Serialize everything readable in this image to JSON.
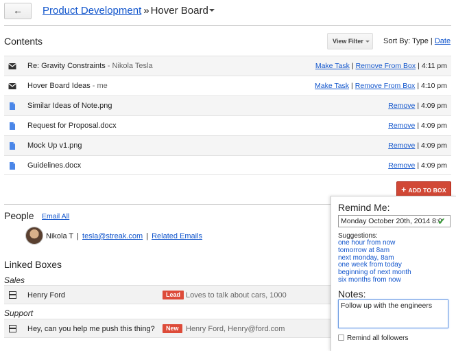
{
  "header": {
    "back_label": "←",
    "breadcrumb_link": "Product Development",
    "breadcrumb_sep": "»",
    "current": "Hover Board"
  },
  "contents": {
    "title": "Contents",
    "view_filter": "View Filter",
    "sort_label": "Sort By:",
    "sort_type": "Type",
    "sort_sep": "|",
    "sort_date": "Date",
    "rows": [
      {
        "icon": "envelope-icon",
        "title": "Re: Gravity Constraints",
        "who": "- Nikola Tesla",
        "a1": "Make Task",
        "a2": "Remove From Box",
        "time": "4:11 pm"
      },
      {
        "icon": "envelope-icon",
        "title": "Hover Board Ideas",
        "who": "- me",
        "a1": "Make Task",
        "a2": "Remove From Box",
        "time": "4:10 pm"
      },
      {
        "icon": "file-icon",
        "title": "Similar Ideas of Note.png",
        "who": "",
        "a1": "",
        "a2": "Remove",
        "time": "4:09 pm"
      },
      {
        "icon": "file-icon",
        "title": "Request for Proposal.docx",
        "who": "",
        "a1": "",
        "a2": "Remove",
        "time": "4:09 pm"
      },
      {
        "icon": "file-icon",
        "title": "Mock Up v1.png",
        "who": "",
        "a1": "",
        "a2": "Remove",
        "time": "4:09 pm"
      },
      {
        "icon": "file-icon",
        "title": "Guidelines.docx",
        "who": "",
        "a1": "",
        "a2": "Remove",
        "time": "4:09 pm"
      }
    ],
    "add_label": "ADD TO BOX"
  },
  "people": {
    "title": "People",
    "email_all": "Email All",
    "name": "Nikola T",
    "email": "tesla@streak.com",
    "related": "Related Emails"
  },
  "linked": {
    "title": "Linked Boxes",
    "groups": [
      {
        "stage": "Sales",
        "name": "Henry Ford",
        "badge": "Lead",
        "snippet": "Loves to talk about cars, 1000"
      },
      {
        "stage": "Support",
        "name": "Hey, can you help me push this thing?",
        "badge": "New",
        "snippet": "Henry Ford, Henry@ford.com"
      }
    ]
  },
  "reminder": {
    "title": "Remind Me:",
    "date_value": "Monday October 20th, 2014 8:0",
    "suggestions_label": "Suggestions:",
    "suggestions": [
      "one hour from now",
      "tomorrow at 8am",
      "next monday, 8am",
      "one week from today",
      "beginning of next month",
      "six months from now"
    ],
    "notes_label": "Notes:",
    "notes_value": "Follow up with the engineers",
    "remind_all": "Remind all followers"
  },
  "colors": {
    "link": "#1155cc",
    "accent_red": "#d14836",
    "badge_red": "#dd4b39",
    "check_green": "#3a9a3a"
  }
}
